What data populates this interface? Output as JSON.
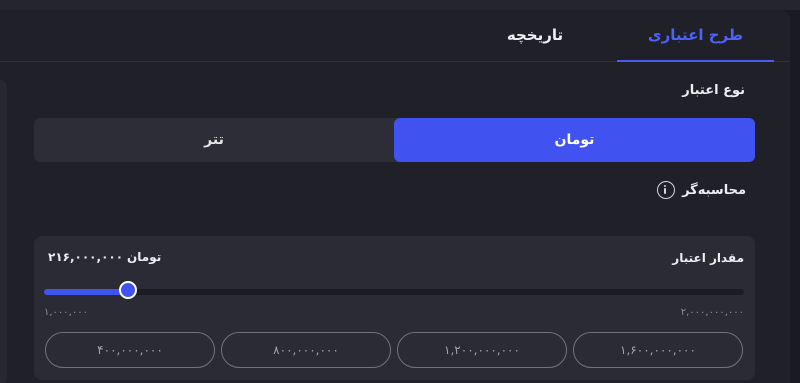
{
  "tabs": {
    "credit_plan": "طرح اعتباری",
    "history": "تاریخچه"
  },
  "credit_type": {
    "label": "نوع اعتبار",
    "options": [
      "تومان",
      "تتر"
    ],
    "selected": "تومان"
  },
  "calculator": {
    "label": "محاسبه‌گر"
  },
  "amount": {
    "label": "مقدار اعتبار",
    "value": "۲۱۶,۰۰۰,۰۰۰",
    "unit": "تومان",
    "min": "۱,۰۰۰,۰۰۰",
    "max": "۲,۰۰۰,۰۰۰,۰۰۰",
    "slider_fraction": 0.12
  },
  "presets": [
    "۱,۶۰۰,۰۰۰,۰۰۰",
    "۱,۲۰۰,۰۰۰,۰۰۰",
    "۸۰۰,۰۰۰,۰۰۰",
    "۴۰۰,۰۰۰,۰۰۰"
  ],
  "colors": {
    "accent": "#4052ef",
    "background": "#1f2028",
    "card": "#2a2b35"
  }
}
